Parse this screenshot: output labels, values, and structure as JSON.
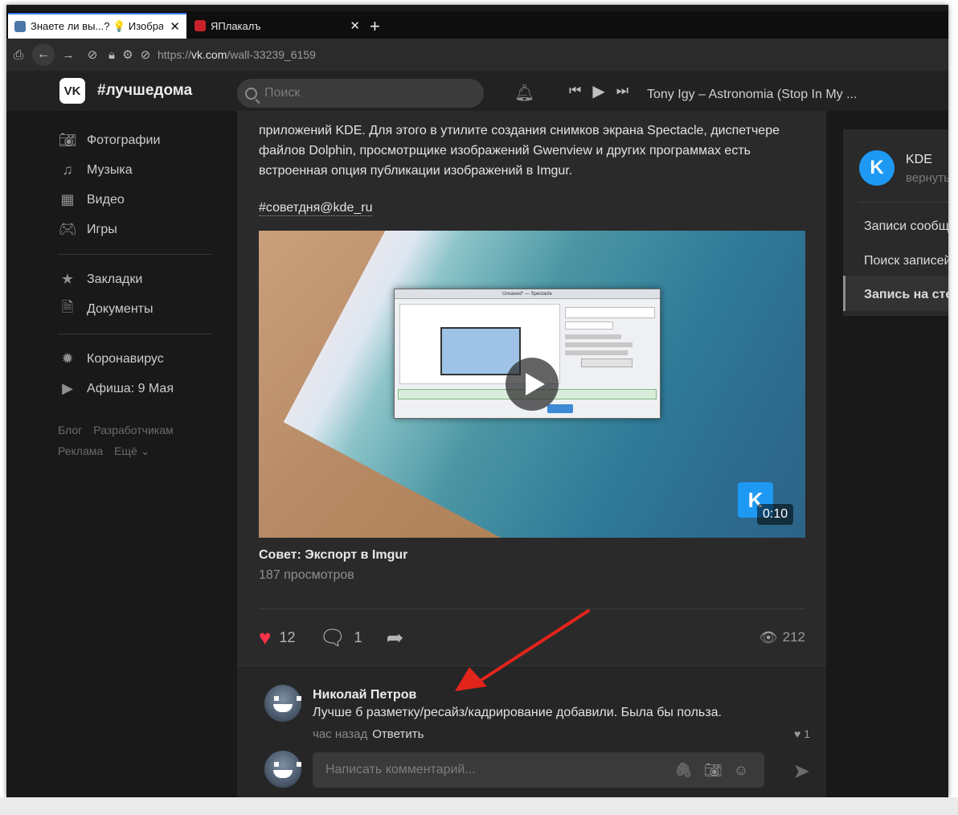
{
  "browser": {
    "tabs": [
      {
        "title": "Знаете ли вы...? 💡 Изображен",
        "active": true
      },
      {
        "title": "ЯПлакалъ",
        "active": false
      }
    ],
    "url_prefix": "https://",
    "url_host": "vk.com",
    "url_path": "/wall-33239_6159"
  },
  "header": {
    "logo": "VK",
    "title": "#лучшедома",
    "search_placeholder": "Поиск",
    "track": "Tony Igy – Astronomia (Stop In My ..."
  },
  "sidebar": {
    "group1": [
      {
        "icon": "camera-icon",
        "label": "Фотографии"
      },
      {
        "icon": "music-icon",
        "label": "Музыка"
      },
      {
        "icon": "video-icon",
        "label": "Видео"
      },
      {
        "icon": "gamepad-icon",
        "label": "Игры"
      }
    ],
    "group2": [
      {
        "icon": "star-icon",
        "label": "Закладки"
      },
      {
        "icon": "document-icon",
        "label": "Документы"
      }
    ],
    "group3": [
      {
        "icon": "virus-icon",
        "label": "Коронавирус"
      },
      {
        "icon": "play-icon",
        "label": "Афиша: 9 Мая"
      }
    ],
    "footer": [
      "Блог",
      "Разработчикам",
      "Реклама",
      "Ещё ⌄"
    ]
  },
  "post": {
    "text": "приложений KDE. Для этого в утилите создания снимков экрана Spectacle, диспетчере файлов Dolphin, просмотрщике изображений Gwenview и других программах есть встроенная опция публикации изображений в Imgur.",
    "hashtag": "#советдня@kde_ru",
    "video": {
      "window_title": "Unsaved* — Spectacle",
      "duration": "0:10",
      "title": "Совет: Экспорт в Imgur",
      "views": "187 просмотров"
    },
    "likes": "12",
    "comments_count": "1",
    "views": "212"
  },
  "comment": {
    "author": "Николай Петров",
    "text": "Лучше б разметку/ресайз/кадрирование добавили. Была бы польза.",
    "time": "час назад",
    "reply": "Ответить",
    "likes": "1",
    "input_placeholder": "Написать комментарий..."
  },
  "right_panel": {
    "name": "KDE",
    "subtitle": "вернуть",
    "items": [
      "Записи сообщества",
      "Поиск записей",
      "Запись на стене"
    ]
  },
  "colors": {
    "accent_like": "#ff3347",
    "kde_blue": "#1d99f3",
    "annotation_red": "#e3241b"
  }
}
